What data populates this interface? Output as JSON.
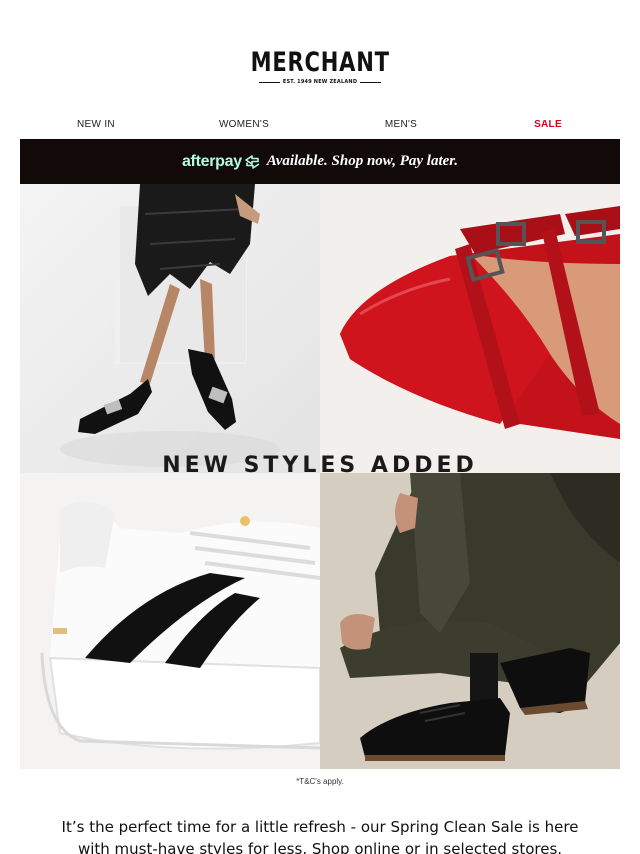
{
  "brand": {
    "name": "MERCHANT",
    "tagline": "EST. 1949 NEW ZEALAND"
  },
  "nav": {
    "items": [
      {
        "label": "NEW IN"
      },
      {
        "label": "WOMEN'S"
      },
      {
        "label": "MEN'S"
      },
      {
        "label": "SALE"
      }
    ]
  },
  "afterpay": {
    "logo_text": "afterpay",
    "message": "Available. Shop now, Pay later.",
    "accent_color": "#b2fce4",
    "background_color": "#120a09"
  },
  "hero": {
    "title": "NEW STYLES ADDED",
    "images": [
      {
        "icon": "womens-black-buckle-heels-image"
      },
      {
        "icon": "red-patent-buckle-pump-image"
      },
      {
        "icon": "white-black-sneaker-image"
      },
      {
        "icon": "mens-black-derby-shoes-image"
      }
    ]
  },
  "terms": "*T&C's apply.",
  "intro": "It’s the perfect time for a little refresh - our Spring Clean Sale is here with must-have styles for less. Shop online or in selected stores.",
  "colors": {
    "sale": "#d9001b",
    "text": "#111111"
  }
}
